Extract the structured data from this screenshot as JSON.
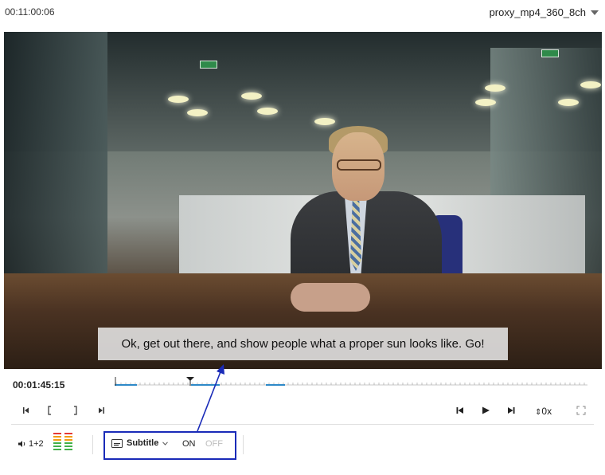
{
  "header": {
    "timecode": "00:11:00:06",
    "proxy_label": "proxy_mp4_360_8ch"
  },
  "player": {
    "subtitle_text": "Ok, get out there, and show people what a proper sun looks like. Go!",
    "current_time": "00:01:45:15"
  },
  "controls": {
    "go_to_in_icon": "go-to-in-icon",
    "mark_in_icon": "mark-in-icon",
    "mark_out_icon": "mark-out-icon",
    "go_to_out_icon": "go-to-out-icon",
    "prev_frame_icon": "step-back-icon",
    "play_icon": "play-icon",
    "next_frame_icon": "step-forward-icon",
    "speed_label": "0x",
    "fullscreen_icon": "fullscreen-icon"
  },
  "bottom_bar": {
    "audio_channels_label": "1+2",
    "subtitle_label": "Subtitle",
    "on_label": "ON",
    "off_label": "OFF"
  },
  "colors": {
    "annotation_blue": "#1a2bb8",
    "timeline_marker": "#2e89c8",
    "meter_red": "#e53935",
    "meter_orange": "#f39c12",
    "meter_green": "#43b049",
    "off_gray": "#bdbdbd"
  }
}
